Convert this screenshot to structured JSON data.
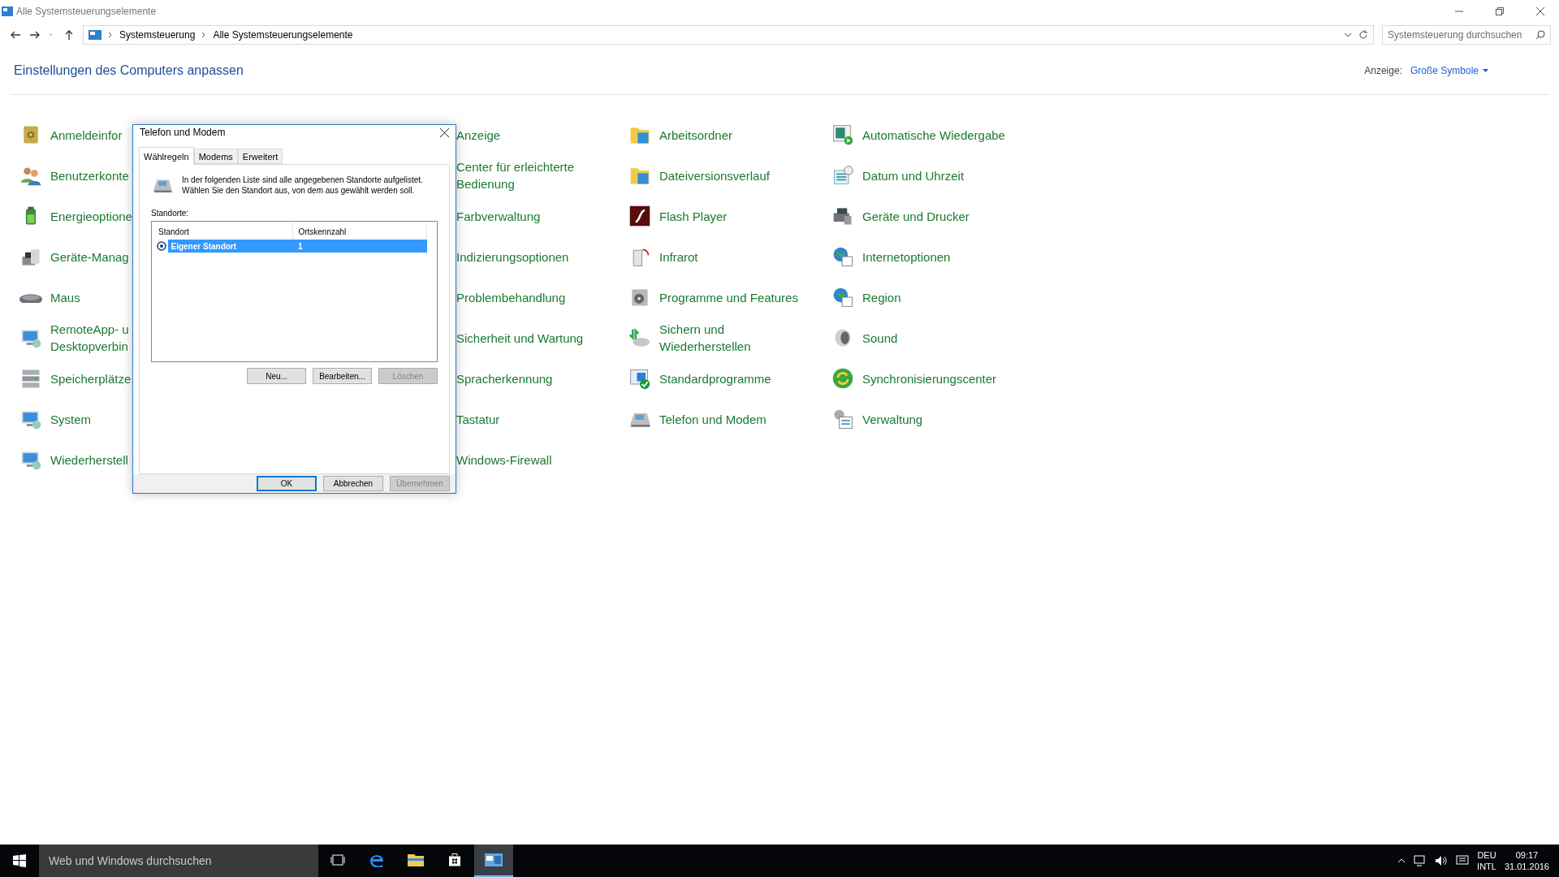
{
  "window": {
    "title": "Alle Systemsteuerungselemente"
  },
  "address_bar": {
    "breadcrumbs": [
      "Systemsteuerung",
      "Alle Systemsteuerungselemente"
    ]
  },
  "search": {
    "placeholder": "Systemsteuerung durchsuchen"
  },
  "header": {
    "title": "Einstellungen des Computers anpassen",
    "view_label": "Anzeige:",
    "view_value": "Große Symbole"
  },
  "columns": [
    [
      {
        "lines": [
          "Anmeldeinfor"
        ]
      },
      {
        "lines": [
          "Benutzerkonte"
        ]
      },
      {
        "lines": [
          "Energieoptione"
        ]
      },
      {
        "lines": [
          "Geräte-Manag"
        ]
      },
      {
        "lines": [
          "Maus"
        ]
      },
      {
        "lines": [
          "RemoteApp- u",
          "Desktopverbin"
        ]
      },
      {
        "lines": [
          "Speicherplätze"
        ]
      },
      {
        "lines": [
          "System"
        ]
      },
      {
        "lines": [
          "Wiederherstell"
        ]
      }
    ],
    [
      {
        "lines": [
          "Anzeige"
        ]
      },
      {
        "lines": [
          "Center für erleichterte",
          "Bedienung"
        ]
      },
      {
        "lines": [
          "Farbverwaltung"
        ]
      },
      {
        "lines": [
          "Indizierungsoptionen"
        ]
      },
      {
        "lines": [
          "Problembehandlung"
        ]
      },
      {
        "lines": [
          "Sicherheit und Wartung"
        ]
      },
      {
        "lines": [
          "Spracherkennung"
        ]
      },
      {
        "lines": [
          "Tastatur"
        ]
      },
      {
        "lines": [
          "Windows-Firewall"
        ]
      }
    ],
    [
      {
        "lines": [
          "Arbeitsordner"
        ]
      },
      {
        "lines": [
          "Dateiversionsverlauf"
        ]
      },
      {
        "lines": [
          "Flash Player"
        ]
      },
      {
        "lines": [
          "Infrarot"
        ]
      },
      {
        "lines": [
          "Programme und Features"
        ]
      },
      {
        "lines": [
          "Sichern und",
          "Wiederherstellen"
        ]
      },
      {
        "lines": [
          "Standardprogramme"
        ]
      },
      {
        "lines": [
          "Telefon und Modem"
        ]
      }
    ],
    [
      {
        "lines": [
          "Automatische Wiedergabe"
        ]
      },
      {
        "lines": [
          "Datum und Uhrzeit"
        ]
      },
      {
        "lines": [
          "Geräte und Drucker"
        ]
      },
      {
        "lines": [
          "Internetoptionen"
        ]
      },
      {
        "lines": [
          "Region"
        ]
      },
      {
        "lines": [
          "Sound"
        ]
      },
      {
        "lines": [
          "Synchronisierungscenter"
        ]
      },
      {
        "lines": [
          "Verwaltung"
        ]
      }
    ]
  ],
  "dialog": {
    "title": "Telefon und Modem",
    "tabs": [
      {
        "label": "Wählregeln",
        "selected": true
      },
      {
        "label": "Modems",
        "selected": false
      },
      {
        "label": "Erweitert",
        "selected": false
      }
    ],
    "description": [
      "In der folgenden Liste sind alle angegebenen Standorte aufgelistet.",
      "Wählen Sie den Standort aus, von dem aus gewählt werden soll."
    ],
    "list_label": "Standorte:",
    "list_columns": [
      "Standort",
      "Ortskennzahl"
    ],
    "list_rows": [
      {
        "cells": [
          "Eigener Standort",
          "1"
        ],
        "selected": true
      }
    ],
    "list_buttons": [
      {
        "label": "Neu...",
        "disabled": false
      },
      {
        "label": "Bearbeiten...",
        "disabled": false
      },
      {
        "label": "Löschen",
        "disabled": true
      }
    ],
    "footer_buttons": [
      {
        "label": "OK",
        "disabled": false,
        "default": true
      },
      {
        "label": "Abbrechen",
        "disabled": false,
        "default": false
      },
      {
        "label": "Übernehmen",
        "disabled": true,
        "default": false
      }
    ]
  },
  "taskbar": {
    "search_placeholder": "Web und Windows durchsuchen",
    "apps": [
      {
        "active": false
      },
      {
        "active": false
      },
      {
        "active": false
      },
      {
        "active": false
      },
      {
        "active": true
      }
    ],
    "language": "DEU",
    "layout": "INTL",
    "time": "09:17",
    "date": "31.01.2016"
  }
}
